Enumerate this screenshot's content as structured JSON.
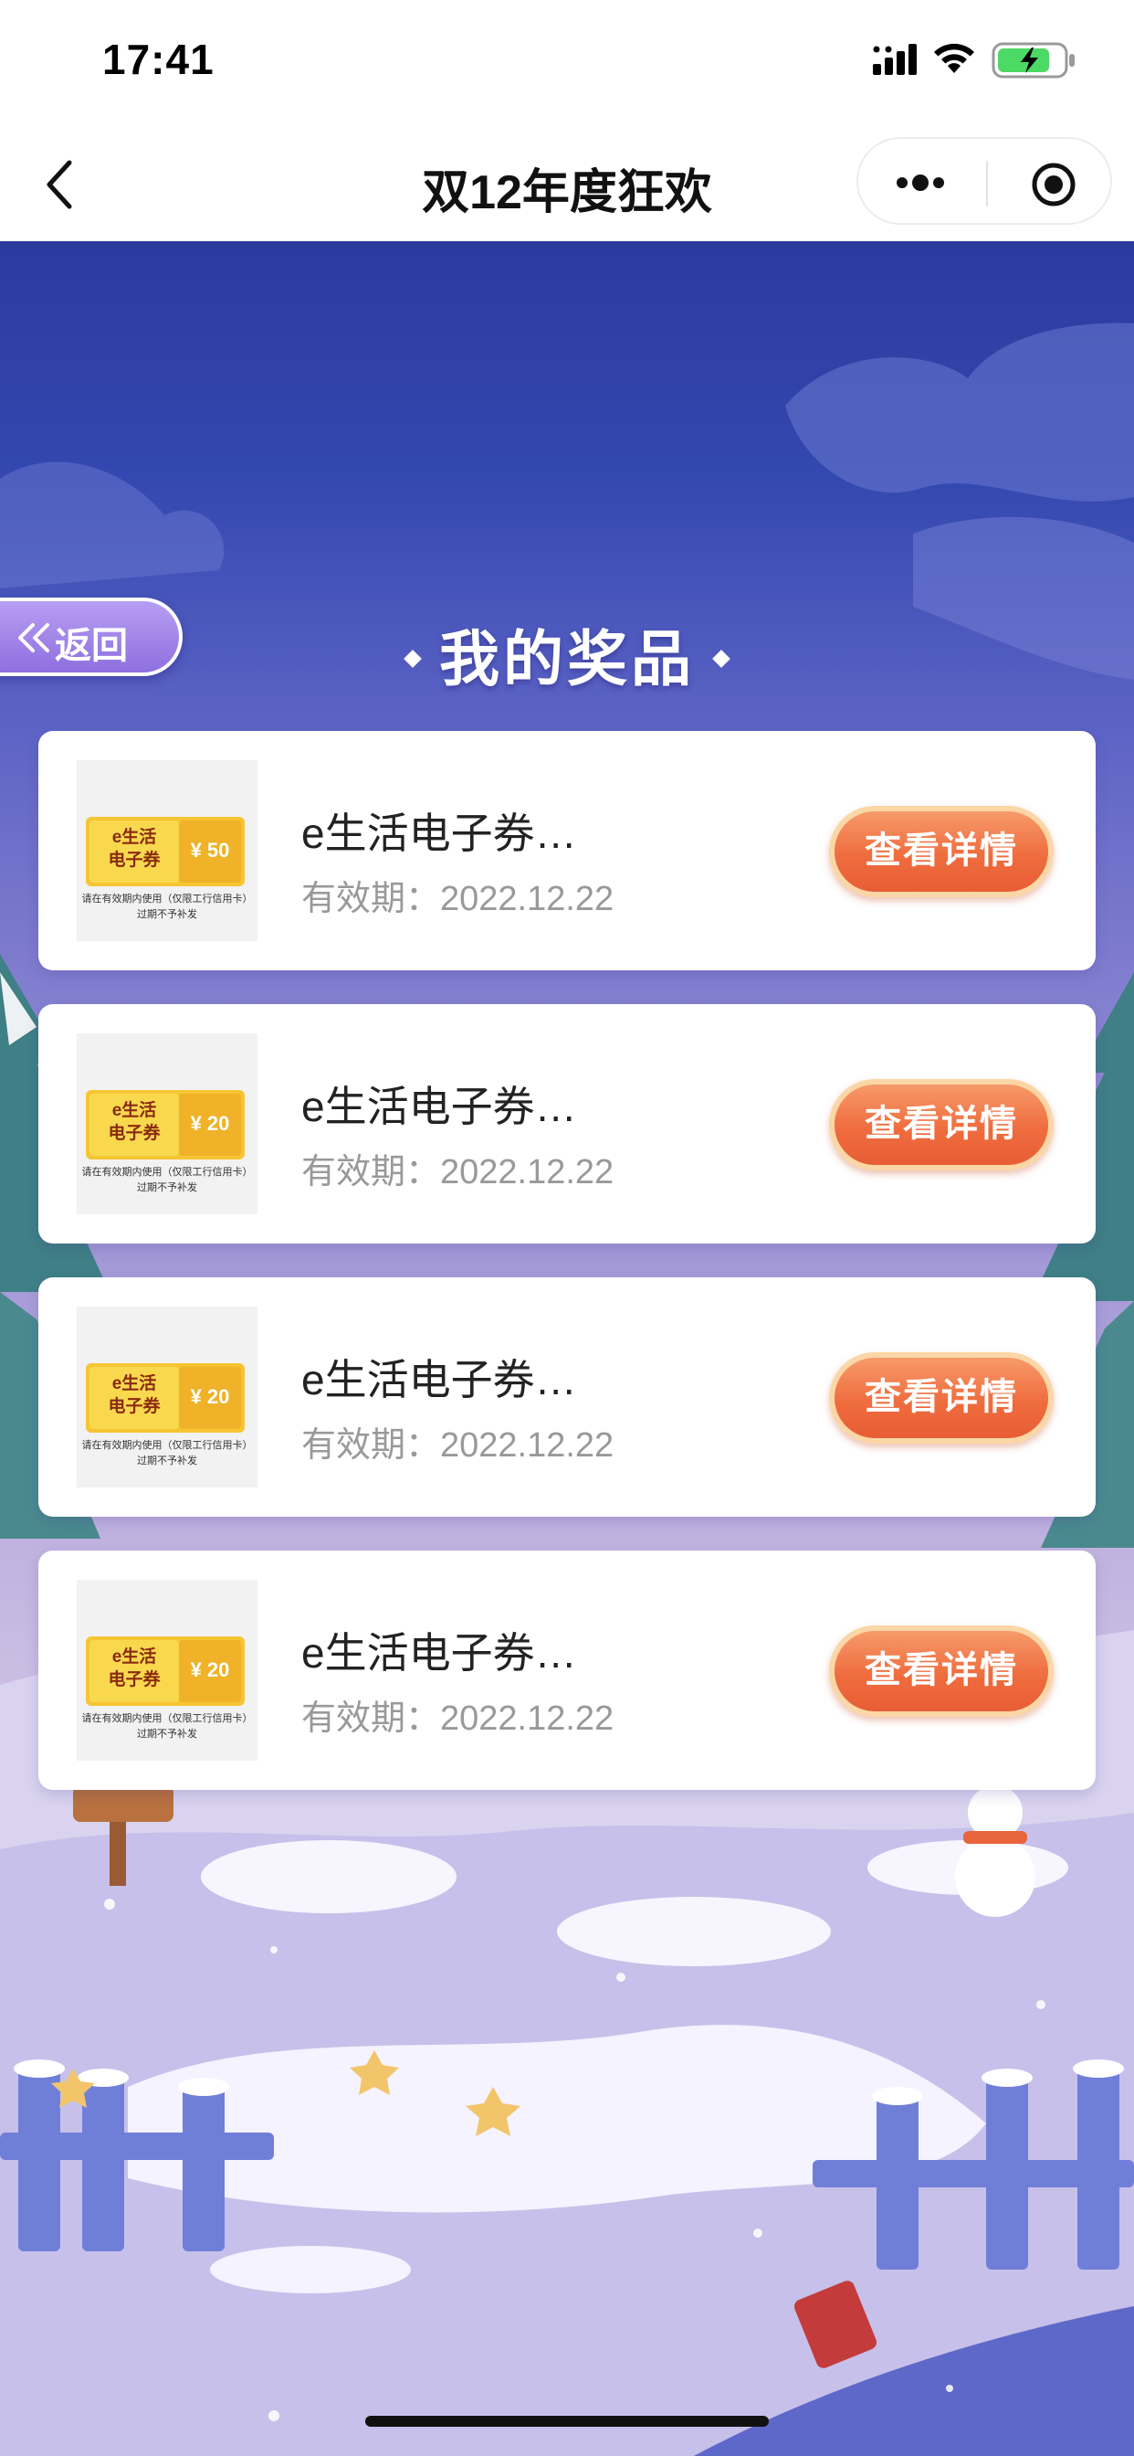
{
  "status_bar": {
    "time": "17:41"
  },
  "nav": {
    "title": "双12年度狂欢"
  },
  "page": {
    "back_label": "返回",
    "section_title": "我的奖品"
  },
  "prizes": [
    {
      "coupon_brand": "e生活\n电子券",
      "coupon_amount": "¥ 50",
      "coupon_note": "请在有效期内使用（仅限工行信用卡）\n过期不予补发",
      "name": "e生活电子券…",
      "validity": "有效期：2022.12.22",
      "button": "查看详情"
    },
    {
      "coupon_brand": "e生活\n电子券",
      "coupon_amount": "¥ 20",
      "coupon_note": "请在有效期内使用（仅限工行信用卡）\n过期不予补发",
      "name": "e生活电子券…",
      "validity": "有效期：2022.12.22",
      "button": "查看详情"
    },
    {
      "coupon_brand": "e生活\n电子券",
      "coupon_amount": "¥ 20",
      "coupon_note": "请在有效期内使用（仅限工行信用卡）\n过期不予补发",
      "name": "e生活电子券…",
      "validity": "有效期：2022.12.22",
      "button": "查看详情"
    },
    {
      "coupon_brand": "e生活\n电子券",
      "coupon_amount": "¥ 20",
      "coupon_note": "请在有效期内使用（仅限工行信用卡）\n过期不予补发",
      "name": "e生活电子券…",
      "validity": "有效期：2022.12.22",
      "button": "查看详情"
    }
  ],
  "colors": {
    "accent": "#ef6d3f",
    "scene_top": "#2c3a9e",
    "scene_bottom": "#a9a0dc",
    "coupon_yellow": "#f6c533"
  },
  "icons": {
    "status": [
      "signal-icon",
      "wifi-icon",
      "battery-charging-icon"
    ],
    "nav": [
      "back-chevron-icon",
      "more-icon",
      "close-target-icon"
    ],
    "back_pill": "double-chevron-left-icon"
  }
}
